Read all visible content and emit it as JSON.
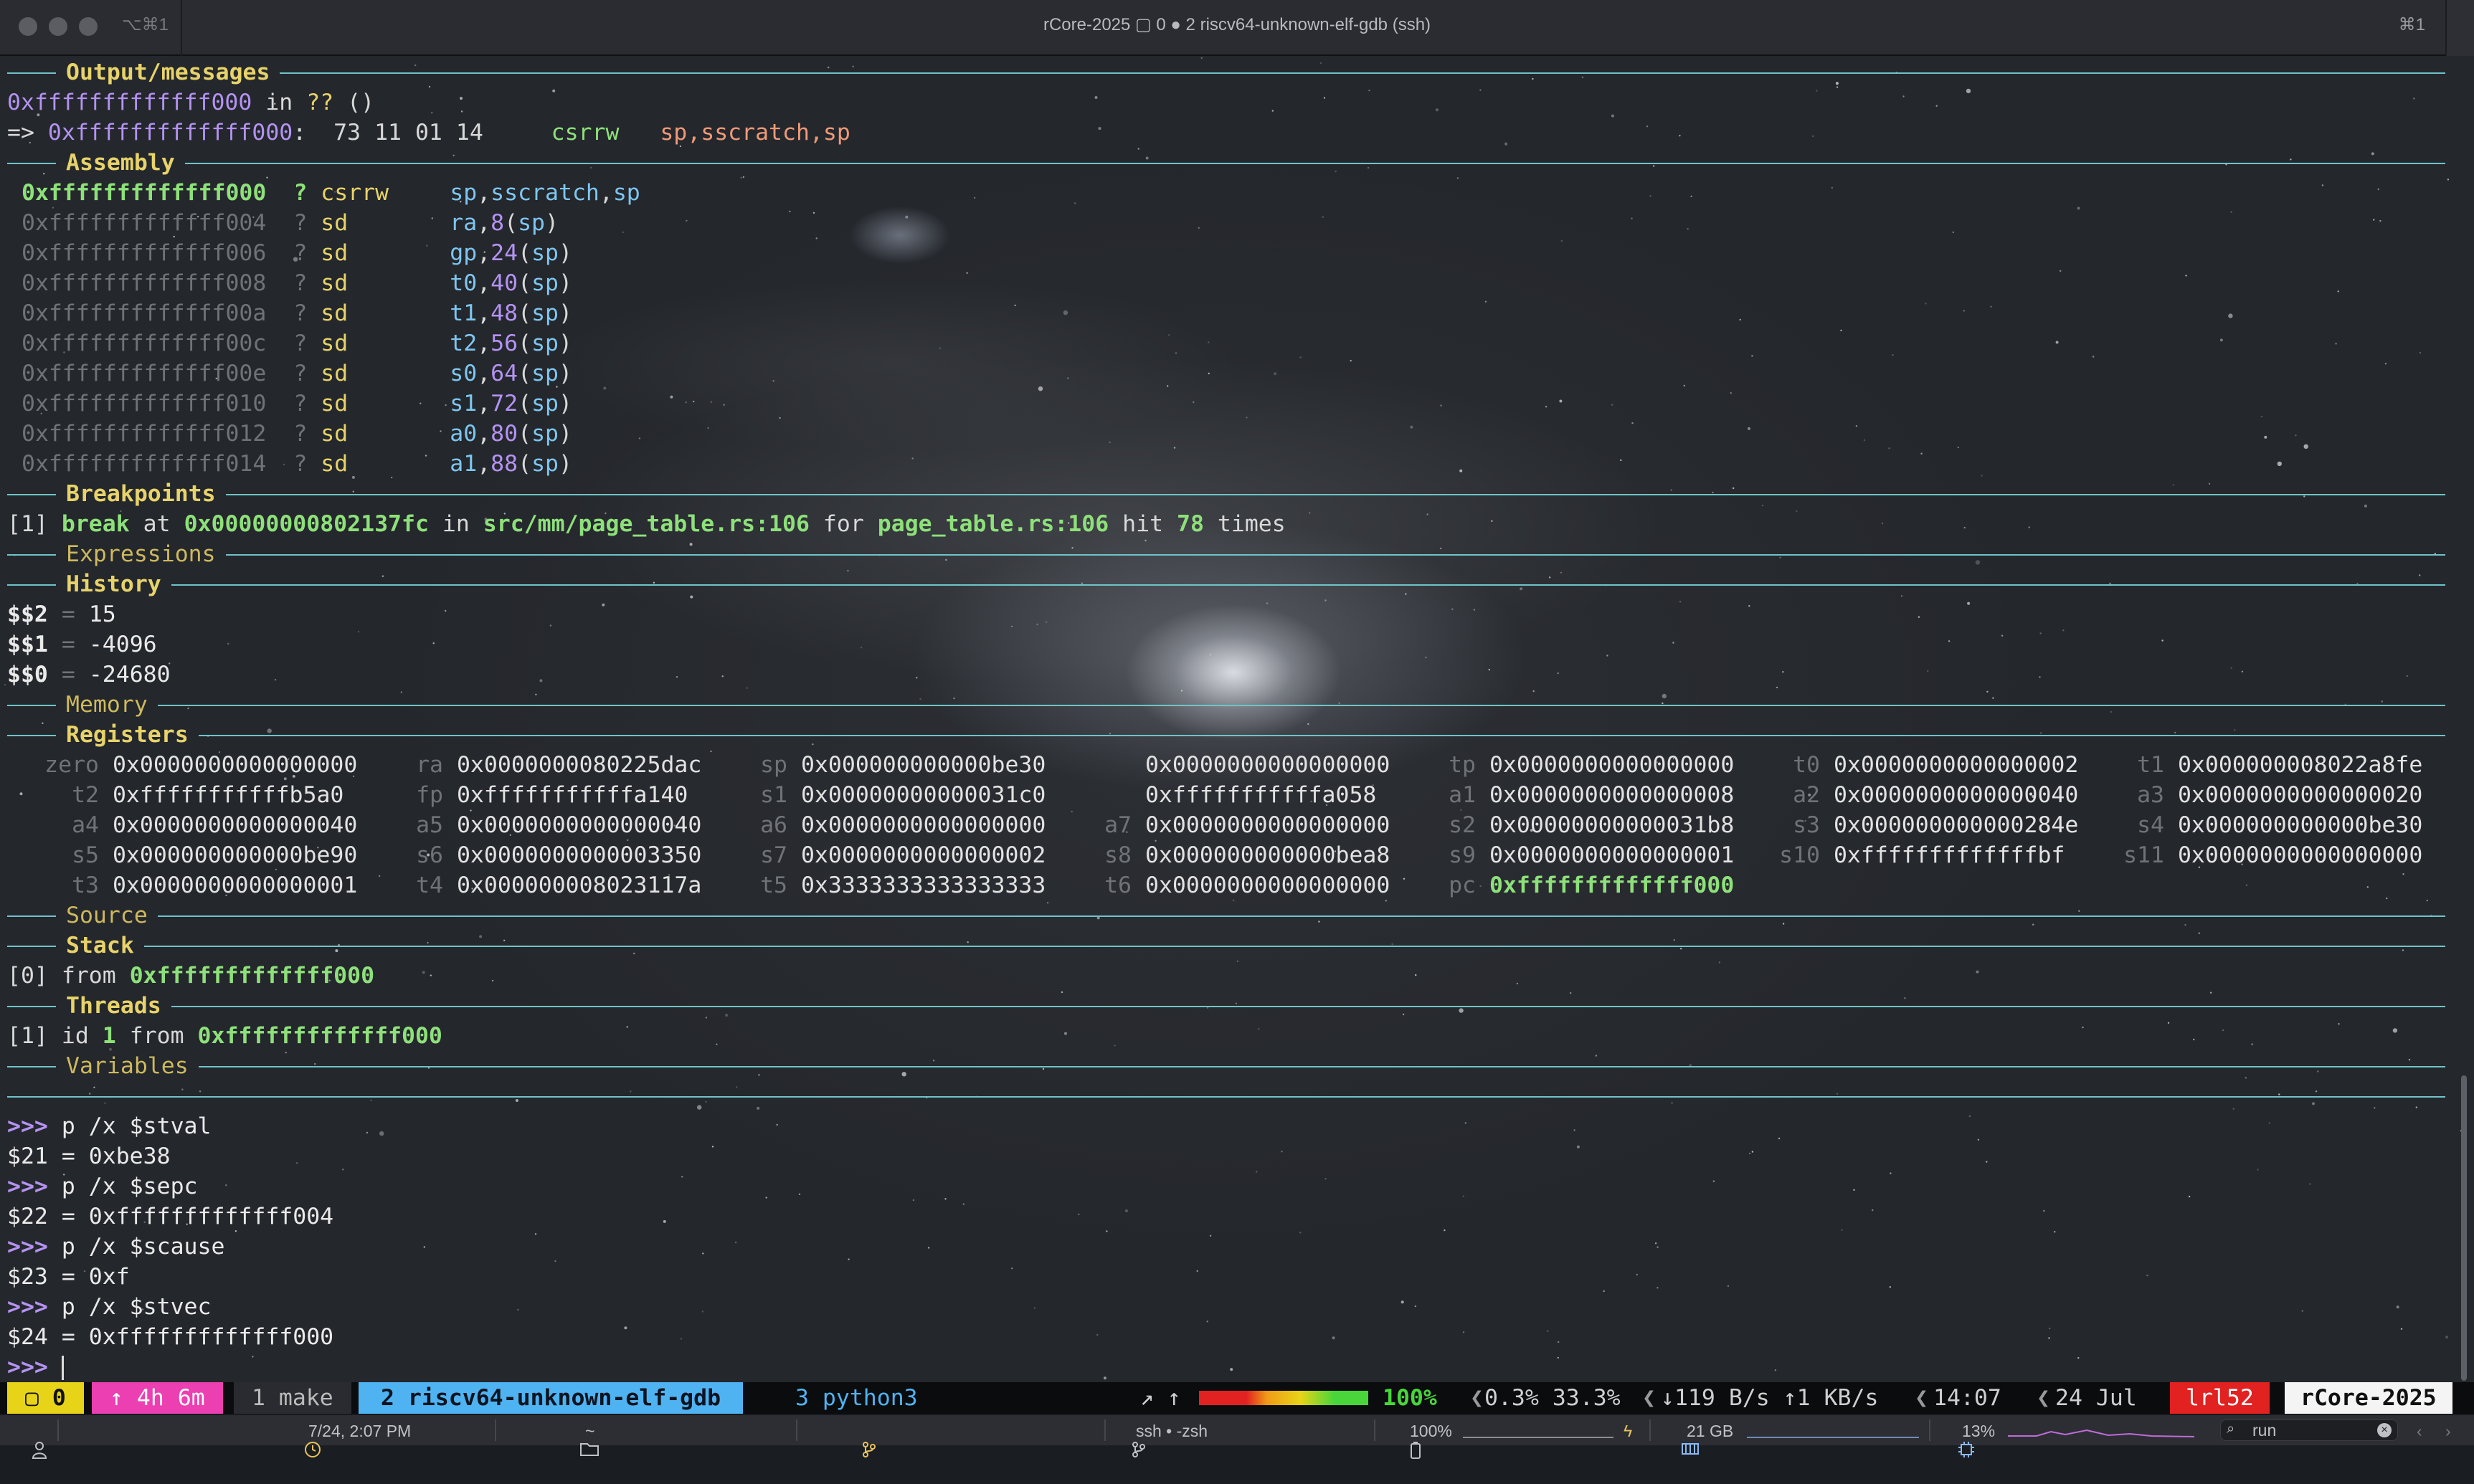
{
  "window": {
    "shortcut_left": "⌥⌘1",
    "title": "rCore-2025 ▢ 0 ● 2 riscv64-unknown-elf-gdb (ssh)",
    "shortcut_right": "⌘1"
  },
  "sections": {
    "output": "Output/messages",
    "assembly": "Assembly",
    "breakpoints": "Breakpoints",
    "expressions": "Expressions",
    "history": "History",
    "memory": "Memory",
    "registers": "Registers",
    "source": "Source",
    "stack": "Stack",
    "threads": "Threads",
    "variables": "Variables"
  },
  "output": {
    "line1_addr": "0xfffffffffffff000",
    "line1_in": " in ",
    "line1_func": "??",
    "line1_paren": " ()",
    "line2_arrow": "=> ",
    "line2_addr": "0xfffffffffffff000",
    "line2_bytes": ":  73 11 01 14     ",
    "line2_op": "csrrw",
    "line2_args": "   sp,sscratch,sp"
  },
  "assembly": [
    {
      "addr": "0xfffffffffffff000",
      "q": "?",
      "op": "csrrw",
      "a1": "sp",
      "c1": ",",
      "a2": "sscratch",
      "c2": ",",
      "a3": "sp",
      "current": true
    },
    {
      "addr": "0xfffffffffffff004",
      "q": "?",
      "op": "sd",
      "a1": "ra",
      "c1": ",",
      "a2": "8",
      "c2": "(",
      "a3": "sp",
      "tail": ")"
    },
    {
      "addr": "0xfffffffffffff006",
      "q": "?",
      "op": "sd",
      "a1": "gp",
      "c1": ",",
      "a2": "24",
      "c2": "(",
      "a3": "sp",
      "tail": ")"
    },
    {
      "addr": "0xfffffffffffff008",
      "q": "?",
      "op": "sd",
      "a1": "t0",
      "c1": ",",
      "a2": "40",
      "c2": "(",
      "a3": "sp",
      "tail": ")"
    },
    {
      "addr": "0xfffffffffffff00a",
      "q": "?",
      "op": "sd",
      "a1": "t1",
      "c1": ",",
      "a2": "48",
      "c2": "(",
      "a3": "sp",
      "tail": ")"
    },
    {
      "addr": "0xfffffffffffff00c",
      "q": "?",
      "op": "sd",
      "a1": "t2",
      "c1": ",",
      "a2": "56",
      "c2": "(",
      "a3": "sp",
      "tail": ")"
    },
    {
      "addr": "0xfffffffffffff00e",
      "q": "?",
      "op": "sd",
      "a1": "s0",
      "c1": ",",
      "a2": "64",
      "c2": "(",
      "a3": "sp",
      "tail": ")"
    },
    {
      "addr": "0xfffffffffffff010",
      "q": "?",
      "op": "sd",
      "a1": "s1",
      "c1": ",",
      "a2": "72",
      "c2": "(",
      "a3": "sp",
      "tail": ")"
    },
    {
      "addr": "0xfffffffffffff012",
      "q": "?",
      "op": "sd",
      "a1": "a0",
      "c1": ",",
      "a2": "80",
      "c2": "(",
      "a3": "sp",
      "tail": ")"
    },
    {
      "addr": "0xfffffffffffff014",
      "q": "?",
      "op": "sd",
      "a1": "a1",
      "c1": ",",
      "a2": "88",
      "c2": "(",
      "a3": "sp",
      "tail": ")"
    }
  ],
  "breakpoint": {
    "idx": "[1]",
    "kw": " break",
    "at": " at ",
    "addr": "0x00000000802137fc",
    "in": " in ",
    "file": "src/mm/page_table.rs:106",
    "for": " for ",
    "loc": "page_table.rs:106",
    "hit": " hit ",
    "count": "78",
    "times": " times"
  },
  "history": [
    {
      "name": "$$2",
      "eq": " = ",
      "value": "15"
    },
    {
      "name": "$$1",
      "eq": " = ",
      "value": "-4096"
    },
    {
      "name": "$$0",
      "eq": " = ",
      "value": "-24680"
    }
  ],
  "registers": [
    [
      {
        "name": "zero",
        "value": "0x0000000000000000"
      },
      {
        "name": "ra",
        "value": "0x0000000080225dac"
      },
      {
        "name": "sp",
        "value": "0x000000000000be30"
      },
      {
        "name": "",
        "value": "0x0000000000000000"
      },
      {
        "name": "tp",
        "value": "0x0000000000000000"
      },
      {
        "name": "t0",
        "value": "0x0000000000000002"
      },
      {
        "name": "t1",
        "value": "0x000000008022a8fe"
      }
    ],
    [
      {
        "name": "t2",
        "value": "0xfffffffffffb5a0"
      },
      {
        "name": "fp",
        "value": "0xfffffffffffa140"
      },
      {
        "name": "s1",
        "value": "0x00000000000031c0"
      },
      {
        "name": "",
        "value": "0xfffffffffffa058"
      },
      {
        "name": "a1",
        "value": "0x0000000000000008"
      },
      {
        "name": "a2",
        "value": "0x0000000000000040"
      },
      {
        "name": "a3",
        "value": "0x0000000000000020"
      }
    ],
    [
      {
        "name": "a4",
        "value": "0x0000000000000040"
      },
      {
        "name": "a5",
        "value": "0x0000000000000040"
      },
      {
        "name": "a6",
        "value": "0x0000000000000000"
      },
      {
        "name": "a7",
        "value": "0x0000000000000000"
      },
      {
        "name": "s2",
        "value": "0x00000000000031b8"
      },
      {
        "name": "s3",
        "value": "0x000000000000284e"
      },
      {
        "name": "s4",
        "value": "0x000000000000be30"
      }
    ],
    [
      {
        "name": "s5",
        "value": "0x000000000000be90"
      },
      {
        "name": "s6",
        "value": "0x0000000000003350"
      },
      {
        "name": "s7",
        "value": "0x0000000000000002"
      },
      {
        "name": "s8",
        "value": "0x000000000000bea8"
      },
      {
        "name": "s9",
        "value": "0x0000000000000001"
      },
      {
        "name": "s10",
        "value": "0xfffffffffffffbf"
      },
      {
        "name": "s11",
        "value": "0x0000000000000000"
      }
    ],
    [
      {
        "name": "t3",
        "value": "0x0000000000000001"
      },
      {
        "name": "t4",
        "value": "0x000000008023117a"
      },
      {
        "name": "t5",
        "value": "0x3333333333333333"
      },
      {
        "name": "t6",
        "value": "0x0000000000000000"
      },
      {
        "name": "pc",
        "value": "0xfffffffffffff000",
        "highlight": true
      }
    ]
  ],
  "stack": {
    "idx": "[0]",
    "from": " from ",
    "addr": "0xfffffffffffff000"
  },
  "threads": {
    "idx": "[1]",
    "id": " id ",
    "num": "1",
    "from": " from ",
    "addr": "0xfffffffffffff000"
  },
  "console": [
    {
      "prompt": ">>> ",
      "cmd": "p /x $stval"
    },
    {
      "out": "$21 = 0xbe38"
    },
    {
      "prompt": ">>> ",
      "cmd": "p /x $sepc"
    },
    {
      "out": "$22 = 0xfffffffffffff004"
    },
    {
      "prompt": ">>> ",
      "cmd": "p /x $scause"
    },
    {
      "out": "$23 = 0xf"
    },
    {
      "prompt": ">>> ",
      "cmd": "p /x $stvec"
    },
    {
      "out": "$24 = 0xfffffffffffff000"
    },
    {
      "prompt": ">>> ",
      "cmd": ""
    }
  ],
  "tmux": {
    "session_idx": " ▢ 0 ",
    "uptime": " ↑ 4h 6m ",
    "win1": " 1 make ",
    "win2": " 2 riscv64-unknown-elf-gdb ",
    "win3": " 3 python3 ",
    "arrows": "↗ ↑",
    "battery": "100%",
    "cpu": "0.3% 33.3%",
    "net": "↓119 B/s ↑1 KB/s",
    "time": "14:07",
    "date": "24 Jul",
    "user": "lrl52",
    "host": "rCore-2025",
    "battery_level": 1.0
  },
  "statusbar": {
    "datetime": "7/24, 2:07 PM",
    "folder": "~",
    "job": "ssh • -zsh",
    "battery": "100%",
    "memory": "21 GB",
    "cpu": "13%",
    "search": "run"
  },
  "colors": {
    "accent_yellow": "#e7d36a",
    "rule_cyan": "#6fc4c9",
    "green": "#8ee07a",
    "blue": "#7ec6f0",
    "purple": "#b493f2",
    "orange": "#ee9a78",
    "tmux_pink": "#ec3fb1",
    "tmux_blue": "#4fb3f2",
    "tmux_red": "#e22121"
  }
}
